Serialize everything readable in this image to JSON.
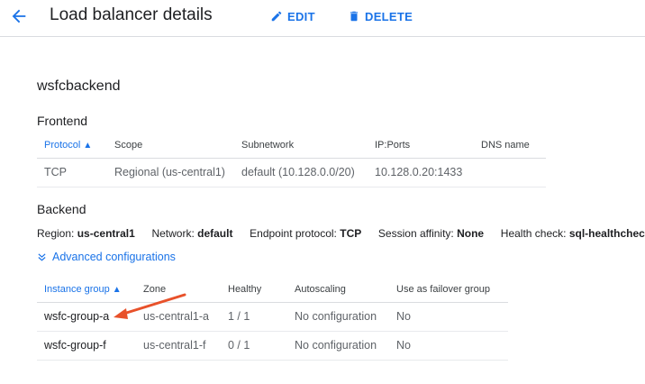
{
  "header": {
    "title": "Load balancer details",
    "edit_label": "EDIT",
    "delete_label": "DELETE"
  },
  "lb_name": "wsfcbackend",
  "frontend": {
    "title": "Frontend",
    "columns": [
      "Protocol",
      "Scope",
      "Subnetwork",
      "IP:Ports",
      "DNS name"
    ],
    "rows": [
      [
        "TCP",
        "Regional (us-central1)",
        "default (10.128.0.0/20)",
        "10.128.0.20:1433",
        ""
      ]
    ]
  },
  "backend": {
    "title": "Backend",
    "region_label": "Region:",
    "region_value": "us-central1",
    "network_label": "Network:",
    "network_value": "default",
    "endpoint_label": "Endpoint protocol:",
    "endpoint_value": "TCP",
    "affinity_label": "Session affinity:",
    "affinity_value": "None",
    "health_label": "Health check:",
    "health_value": "sql-healthcheck",
    "advanced_label": "Advanced configurations",
    "columns": [
      "Instance group",
      "Zone",
      "Healthy",
      "Autoscaling",
      "Use as failover group"
    ],
    "rows": [
      [
        "wsfc-group-a",
        "us-central1-a",
        "1 / 1",
        "No configuration",
        "No"
      ],
      [
        "wsfc-group-f",
        "us-central1-f",
        "0 / 1",
        "No configuration",
        "No"
      ]
    ]
  },
  "colors": {
    "accent": "#1a73e8",
    "annotation_arrow": "#e8512a"
  },
  "icons": [
    "arrow-back-icon",
    "pencil-icon",
    "trash-icon",
    "chevron-double-down-icon",
    "sort-up-icon"
  ]
}
